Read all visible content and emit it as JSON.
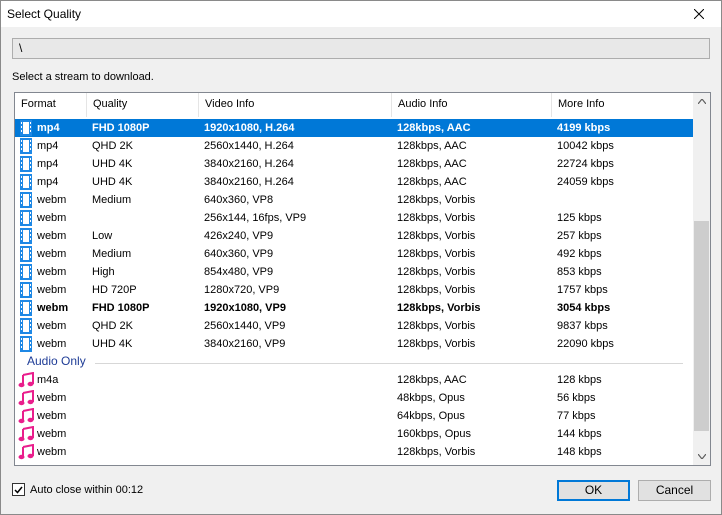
{
  "window": {
    "title": "Select Quality"
  },
  "path_value": "\\",
  "instruction": "Select a stream to download.",
  "columns": [
    "Format",
    "Quality",
    "Video Info",
    "Audio Info",
    "More Info"
  ],
  "video_rows": [
    {
      "format": "mp4",
      "quality": "FHD 1080P",
      "video": "1920x1080, H.264",
      "audio": "128kbps, AAC",
      "more": "4199 kbps",
      "style": "selected"
    },
    {
      "format": "mp4",
      "quality": "QHD 2K",
      "video": "2560x1440, H.264",
      "audio": "128kbps, AAC",
      "more": "10042 kbps",
      "style": ""
    },
    {
      "format": "mp4",
      "quality": "UHD 4K",
      "video": "3840x2160, H.264",
      "audio": "128kbps, AAC",
      "more": "22724 kbps",
      "style": ""
    },
    {
      "format": "mp4",
      "quality": "UHD 4K",
      "video": "3840x2160, H.264",
      "audio": "128kbps, AAC",
      "more": "24059 kbps",
      "style": ""
    },
    {
      "format": "webm",
      "quality": "Medium",
      "video": "640x360, VP8",
      "audio": "128kbps, Vorbis",
      "more": "",
      "style": ""
    },
    {
      "format": "webm",
      "quality": "",
      "video": "256x144, 16fps, VP9",
      "audio": "128kbps, Vorbis",
      "more": "125 kbps",
      "style": ""
    },
    {
      "format": "webm",
      "quality": "Low",
      "video": "426x240, VP9",
      "audio": "128kbps, Vorbis",
      "more": "257 kbps",
      "style": ""
    },
    {
      "format": "webm",
      "quality": "Medium",
      "video": "640x360, VP9",
      "audio": "128kbps, Vorbis",
      "more": "492 kbps",
      "style": ""
    },
    {
      "format": "webm",
      "quality": "High",
      "video": "854x480, VP9",
      "audio": "128kbps, Vorbis",
      "more": "853 kbps",
      "style": ""
    },
    {
      "format": "webm",
      "quality": "HD 720P",
      "video": "1280x720, VP9",
      "audio": "128kbps, Vorbis",
      "more": "1757 kbps",
      "style": ""
    },
    {
      "format": "webm",
      "quality": "FHD 1080P",
      "video": "1920x1080, VP9",
      "audio": "128kbps, Vorbis",
      "more": "3054 kbps",
      "style": "bold"
    },
    {
      "format": "webm",
      "quality": "QHD 2K",
      "video": "2560x1440, VP9",
      "audio": "128kbps, Vorbis",
      "more": "9837 kbps",
      "style": ""
    },
    {
      "format": "webm",
      "quality": "UHD 4K",
      "video": "3840x2160, VP9",
      "audio": "128kbps, Vorbis",
      "more": "22090 kbps",
      "style": ""
    }
  ],
  "audio_group_label": "Audio Only",
  "audio_rows": [
    {
      "format": "m4a",
      "audio": "128kbps, AAC",
      "more": "128 kbps"
    },
    {
      "format": "webm",
      "audio": "48kbps, Opus",
      "more": "56 kbps"
    },
    {
      "format": "webm",
      "audio": "64kbps, Opus",
      "more": "77 kbps"
    },
    {
      "format": "webm",
      "audio": "160kbps, Opus",
      "more": "144 kbps"
    },
    {
      "format": "webm",
      "audio": "128kbps, Vorbis",
      "more": "148 kbps"
    }
  ],
  "auto_close": {
    "label": "Auto close within 00:12",
    "checked": true
  },
  "buttons": {
    "ok": "OK",
    "cancel": "Cancel"
  },
  "colors": {
    "selection": "#0078d7",
    "video_icon": "#1e88e5",
    "audio_icon": "#e91e8c",
    "group_label": "#1e3c96"
  },
  "icons": {
    "video": "film-icon",
    "audio": "music-note-icon"
  }
}
